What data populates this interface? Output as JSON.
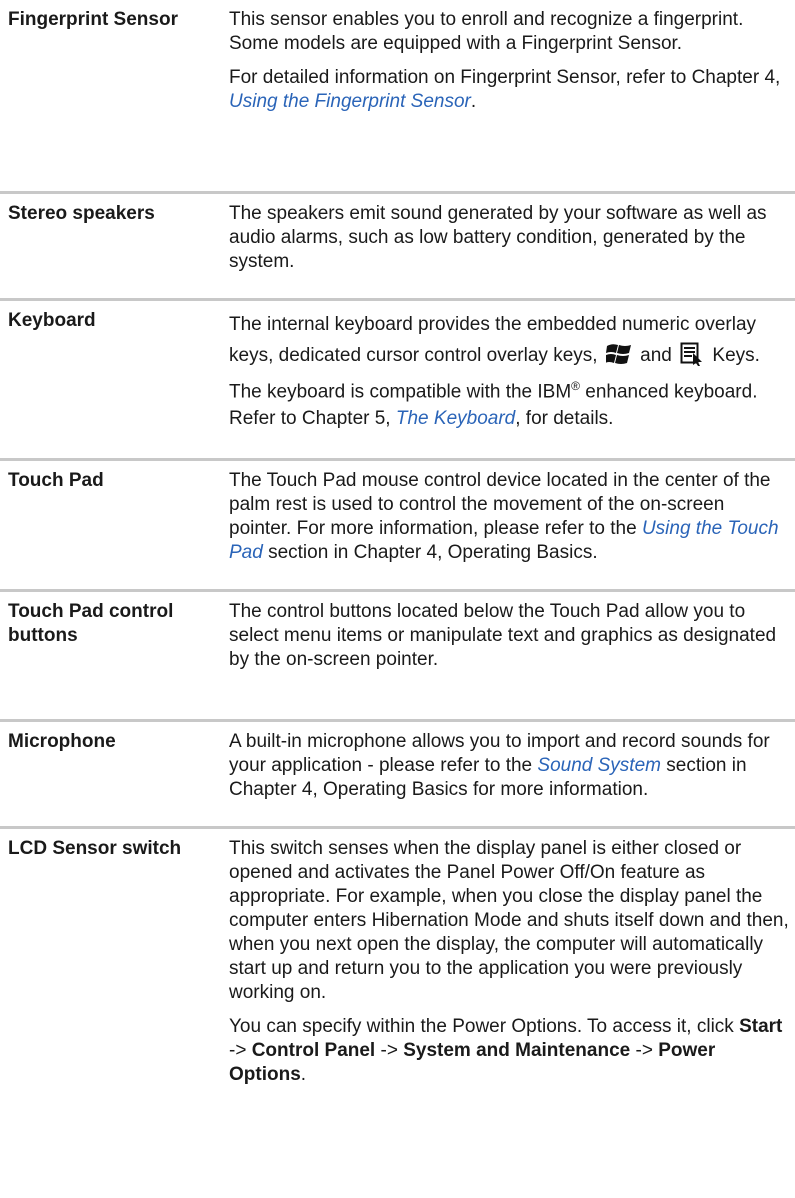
{
  "rows": [
    {
      "term": "Fingerprint Sensor",
      "d1": "This sensor enables you to enroll and recognize a fingerprint.",
      "d2": "Some models are equipped with a Fingerprint Sensor.",
      "d3a": "For detailed information on Fingerprint Sensor, refer to Chapter 4, ",
      "d3link": "Using the Fingerprint Sensor",
      "d3b": "."
    },
    {
      "term": "Stereo speakers",
      "d1": "The speakers emit sound generated by your software as well as audio alarms, such as low battery condition, generated by the system."
    },
    {
      "term": "Keyboard",
      "d1a": "The internal keyboard provides the embedded numeric overlay keys, dedicated cursor control overlay keys,",
      "d1and": "and",
      "d1b": "Keys. The keyboard is compatible with the IBM",
      "d1reg": "®",
      "d1c": " enhanced keyboard.",
      "d2a": "Refer to Chapter 5, ",
      "d2link": "The Keyboard",
      "d2b": ", for details."
    },
    {
      "term": "Touch Pad",
      "d1a": "The Touch Pad mouse control device located in the center of the palm rest is used to control the movement of the on-screen pointer. For more information, please refer to the ",
      "d1link": "Using the Touch Pad",
      "d1b": " section in Chapter 4, Operating Basics."
    },
    {
      "term": "Touch Pad control buttons",
      "d1": "The control buttons located below the Touch Pad allow you to select menu items or manipulate text and graphics as designated by the on-screen pointer."
    },
    {
      "term": "Microphone",
      "d1a": "A built-in microphone allows you to import and record sounds for your application - please refer to the ",
      "d1link": "Sound System",
      "d1b": " section in Chapter 4, Operating Basics for more information."
    },
    {
      "term": "LCD Sensor switch",
      "d1": "This switch senses when the display panel is either closed or opened and activates the Panel Power Off/On feature as appropriate. For example, when you close the display panel the computer enters Hibernation Mode and shuts itself down and then, when you next open the display, the computer will automatically start up and return you to the application you were previously working on.",
      "d2a": "You can specify within the Power Options. To access it, click ",
      "d2start": "Start",
      "d2arrow1": " -> ",
      "d2cp": "Control Panel",
      "d2arrow2": " -> ",
      "d2sm": "System and Maintenance",
      "d2arrow3": " -> ",
      "d2po": "Power Options",
      "d2end": "."
    }
  ],
  "icons": {
    "windows": "windows-logo-icon",
    "application": "application-menu-icon"
  }
}
